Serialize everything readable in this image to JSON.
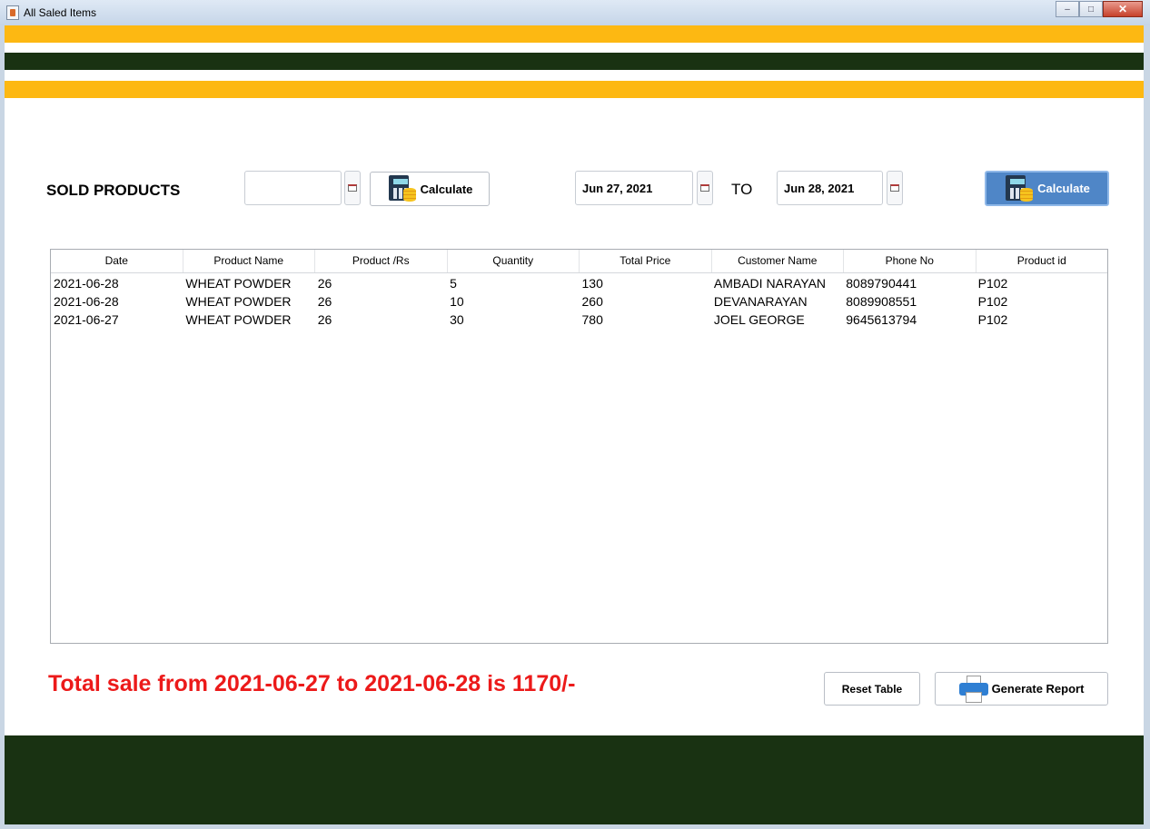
{
  "window": {
    "title": "All Saled Items",
    "controls": {
      "minimize": "–",
      "maximize": "□",
      "close": "✕"
    }
  },
  "header": {
    "heading": "SOLD PRODUCTS"
  },
  "single_date": {
    "value": "",
    "calendar_icon": "calendar-icon",
    "calculate_label": "Calculate",
    "calculate_icon": "calculator-coins-icon"
  },
  "range": {
    "from": "Jun 27, 2021",
    "to_label": "TO",
    "to": "Jun 28, 2021",
    "calculate_label": "Calculate",
    "calculate_icon": "calculator-coins-icon"
  },
  "table": {
    "columns": [
      "Date",
      "Product Name",
      "Product /Rs",
      "Quantity",
      "Total Price",
      "Customer Name",
      "Phone No",
      "Product id"
    ],
    "rows": [
      [
        "2021-06-28",
        "WHEAT POWDER",
        "26",
        "5",
        "130",
        "AMBADI NARAYAN",
        "8089790441",
        "P102"
      ],
      [
        "2021-06-28",
        "WHEAT POWDER",
        "26",
        "10",
        "260",
        "DEVANARAYAN",
        "8089908551",
        "P102"
      ],
      [
        "2021-06-27",
        "WHEAT POWDER",
        "26",
        "30",
        "780",
        "JOEL GEORGE",
        "9645613794",
        "P102"
      ]
    ]
  },
  "summary": {
    "total_text": "Total sale from 2021-06-27 to 2021-06-28 is 1170/-"
  },
  "actions": {
    "reset_label": "Reset Table",
    "report_label": "Generate Report",
    "report_icon": "printer-icon"
  },
  "colors": {
    "stripe_yellow": "#fdb812",
    "stripe_green": "#193212",
    "accent_blue": "#4f86c7",
    "total_red": "#ec1a1a"
  }
}
